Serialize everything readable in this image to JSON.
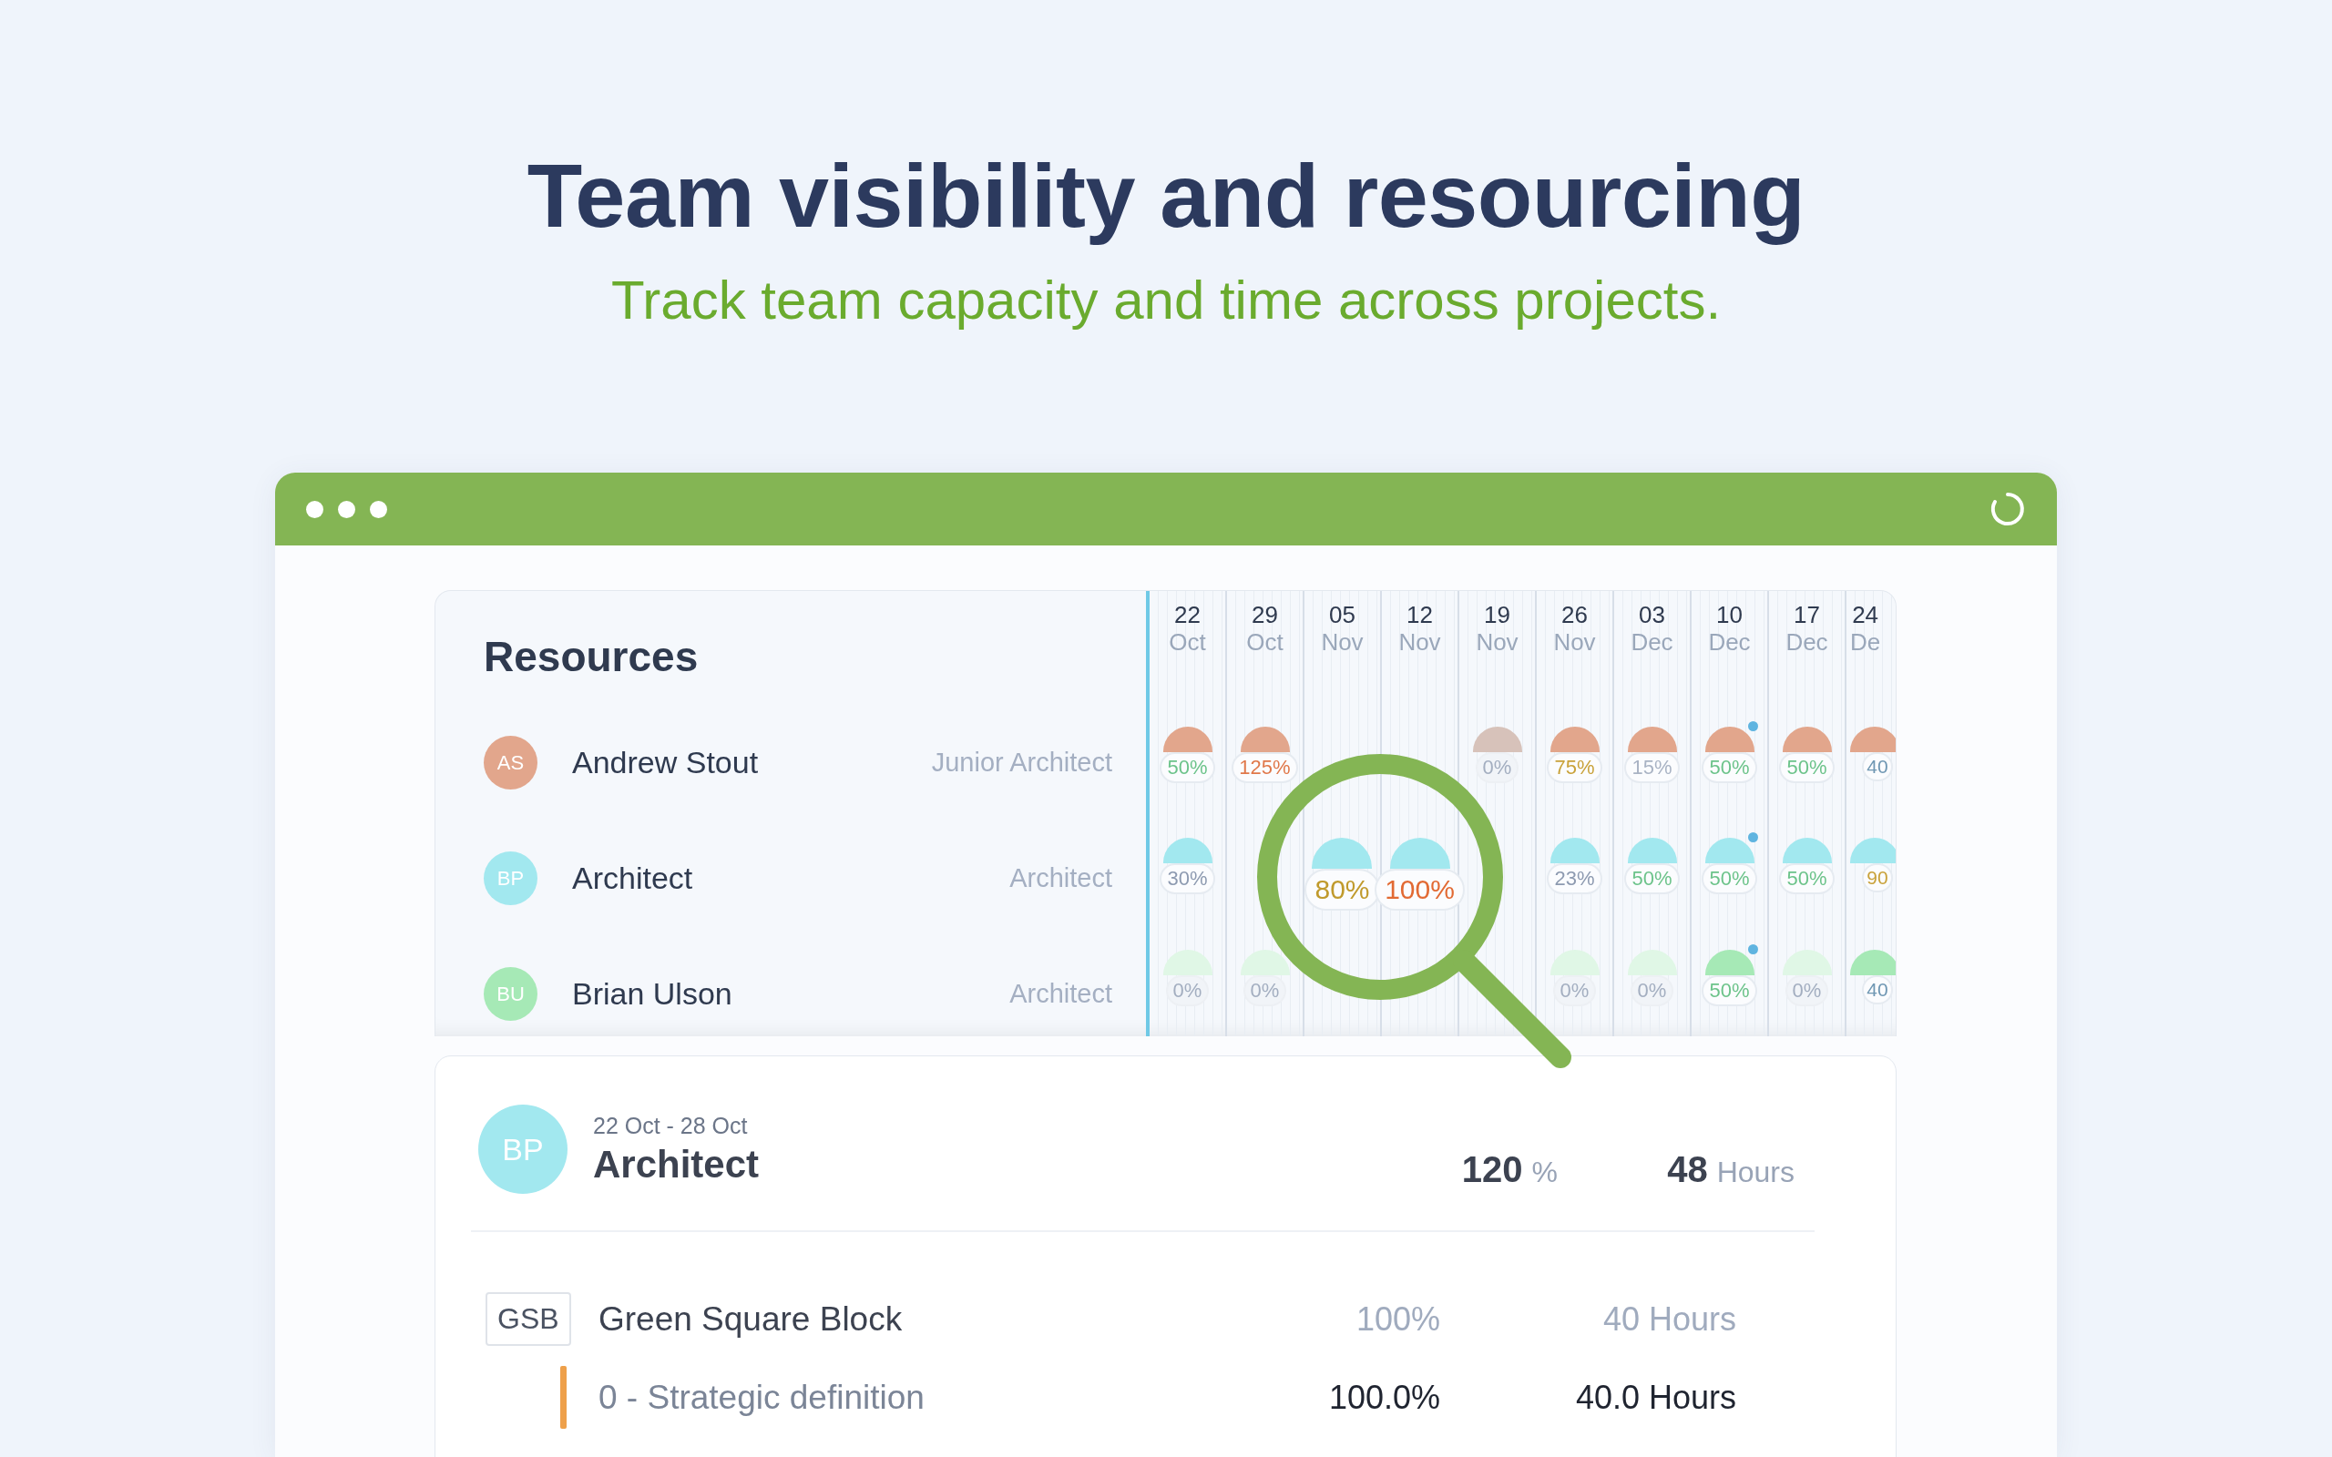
{
  "hero": {
    "title": "Team visibility and resourcing",
    "subtitle": "Track team capacity and time across projects."
  },
  "resources": {
    "title": "Resources",
    "weeks": [
      {
        "day": "22",
        "month": "Oct"
      },
      {
        "day": "29",
        "month": "Oct"
      },
      {
        "day": "05",
        "month": "Nov"
      },
      {
        "day": "12",
        "month": "Nov"
      },
      {
        "day": "19",
        "month": "Nov"
      },
      {
        "day": "26",
        "month": "Nov"
      },
      {
        "day": "03",
        "month": "Dec"
      },
      {
        "day": "10",
        "month": "Dec"
      },
      {
        "day": "17",
        "month": "Dec"
      },
      {
        "day": "24",
        "month": "De"
      }
    ],
    "people": [
      {
        "initials": "AS",
        "name": "Andrew Stout",
        "role": "Junior Architect",
        "color": "#e2a68c",
        "cells": [
          {
            "percent": "50%",
            "color": "#6cc38a",
            "faded": false,
            "dot": false,
            "zoomed": false
          },
          {
            "percent": "125%",
            "color": "#e0784a",
            "faded": false,
            "dot": false,
            "zoomed": false
          },
          null,
          null,
          {
            "percent": "0%",
            "color": "#a3aec0",
            "faded": true,
            "dot": false,
            "zoomed": false
          },
          {
            "percent": "75%",
            "color": "#c9a23a",
            "faded": false,
            "dot": false,
            "zoomed": false
          },
          {
            "percent": "15%",
            "color": "#a9b3c4",
            "faded": false,
            "dot": false,
            "zoomed": false
          },
          {
            "percent": "50%",
            "color": "#6cc38a",
            "faded": false,
            "dot": true,
            "zoomed": false
          },
          {
            "percent": "50%",
            "color": "#6cc38a",
            "faded": false,
            "dot": false,
            "zoomed": false
          },
          {
            "percent": "40",
            "color": "#6f97b3",
            "faded": false,
            "dot": false,
            "zoomed": false
          }
        ]
      },
      {
        "initials": "BP",
        "name": "Architect",
        "role": "Architect",
        "color": "#a2e8ef",
        "cells": [
          {
            "percent": "30%",
            "color": "#8d9ab0",
            "faded": false,
            "dot": false,
            "zoomed": false
          },
          null,
          {
            "percent": "80%",
            "color": "#c09a2c",
            "faded": false,
            "dot": false,
            "zoomed": true
          },
          {
            "percent": "100%",
            "color": "#e26a33",
            "faded": false,
            "dot": false,
            "zoomed": true
          },
          null,
          {
            "percent": "23%",
            "color": "#8d9ab0",
            "faded": false,
            "dot": false,
            "zoomed": false
          },
          {
            "percent": "50%",
            "color": "#6cc38a",
            "faded": false,
            "dot": false,
            "zoomed": false
          },
          {
            "percent": "50%",
            "color": "#6cc38a",
            "faded": false,
            "dot": true,
            "zoomed": false
          },
          {
            "percent": "50%",
            "color": "#6cc38a",
            "faded": false,
            "dot": false,
            "zoomed": false
          },
          {
            "percent": "90",
            "color": "#c9a23a",
            "faded": false,
            "dot": false,
            "zoomed": false
          }
        ]
      },
      {
        "initials": "BU",
        "name": "Brian Ulson",
        "role": "Architect",
        "color": "#a6e9b6",
        "cells": [
          {
            "percent": "0%",
            "color": "#a3aec0",
            "faded": true,
            "dot": false,
            "zoomed": false
          },
          {
            "percent": "0%",
            "color": "#a3aec0",
            "faded": true,
            "dot": false,
            "zoomed": false
          },
          null,
          null,
          null,
          {
            "percent": "0%",
            "color": "#a3aec0",
            "faded": true,
            "dot": false,
            "zoomed": false
          },
          {
            "percent": "0%",
            "color": "#a3aec0",
            "faded": true,
            "dot": false,
            "zoomed": false
          },
          {
            "percent": "50%",
            "color": "#6cc38a",
            "faded": false,
            "dot": true,
            "zoomed": false
          },
          {
            "percent": "0%",
            "color": "#a3aec0",
            "faded": true,
            "dot": false,
            "zoomed": false
          },
          {
            "percent": "40",
            "color": "#6f97b3",
            "faded": false,
            "dot": false,
            "zoomed": false
          }
        ]
      }
    ]
  },
  "detail": {
    "initials": "BP",
    "color": "#a2e8ef",
    "range": "22 Oct - 28 Oct",
    "name": "Architect",
    "percent_value": "120",
    "percent_unit": "%",
    "hours_value": "48",
    "hours_unit": "Hours",
    "projects": [
      {
        "code": "GSB",
        "name": "Green Square Block",
        "percent": "100%",
        "hours": "40 Hours",
        "phases": [
          {
            "name": "0 - Strategic definition",
            "color": "#eea04a",
            "percent": "100.0%",
            "hours": "40.0 Hours"
          }
        ]
      }
    ]
  }
}
